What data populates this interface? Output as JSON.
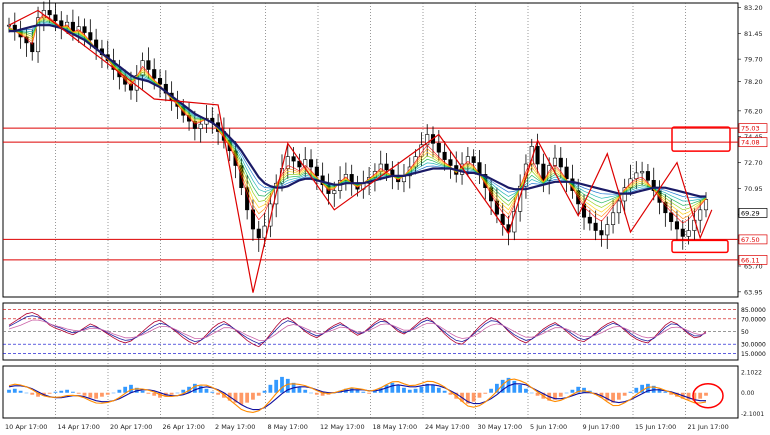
{
  "colors": {
    "background": "#ffffff",
    "grid": "#000000",
    "candle": "#000000",
    "ma": "#1a1a66",
    "zigzag": "#dd0000",
    "level_lines": "#dd0000",
    "highlight_box": "#ff0000",
    "rsi_fast": "#b00030",
    "rsi_slow": "#2020a0",
    "rsi_levels_upper": "#cc0000",
    "rsi_levels_lower": "#0000cc",
    "macd_signal": "#1010a0",
    "macd_line": "#ff8c00",
    "hist_pos": "#3399ff",
    "hist_neg": "#ff9966"
  },
  "chart_data": [
    {
      "type": "candlestick",
      "panel": "main",
      "price_axis_ticks": [
        "83.20",
        "81.45",
        "79.70",
        "78.20",
        "76.20",
        "74.45",
        "72.70",
        "70.95",
        "69.20",
        "67.45",
        "65.70",
        "63.95"
      ],
      "price_tags": [
        {
          "label": "75.03",
          "style": "red"
        },
        {
          "label": "74.08",
          "style": "red"
        },
        {
          "label": "69.29",
          "style": "current"
        },
        {
          "label": "67.50",
          "style": "red"
        },
        {
          "label": "66.11",
          "style": "red"
        }
      ],
      "horizontal_levels": [
        75.03,
        74.08,
        67.5,
        66.11
      ],
      "ylim": [
        63.6,
        83.5
      ],
      "close_series": [
        82.0,
        81.6,
        81.2,
        80.8,
        80.2,
        82.5,
        83.0,
        82.7,
        82.3,
        81.9,
        82.2,
        81.6,
        81.9,
        81.5,
        81.0,
        80.4,
        80.0,
        79.6,
        79.0,
        78.5,
        78.0,
        77.6,
        78.6,
        79.6,
        79.0,
        78.4,
        78.0,
        77.4,
        76.9,
        76.5,
        75.9,
        75.5,
        75.0,
        75.3,
        75.7,
        75.4,
        74.8,
        74.2,
        73.5,
        72.5,
        71.0,
        69.5,
        68.2,
        67.6,
        68.4,
        69.9,
        71.3,
        72.3,
        73.1,
        72.8,
        72.4,
        72.9,
        72.4,
        71.8,
        71.2,
        70.6,
        70.8,
        71.5,
        71.9,
        71.3,
        70.9,
        71.3,
        71.7,
        72.1,
        72.6,
        72.2,
        71.8,
        71.4,
        71.8,
        72.4,
        73.1,
        73.9,
        74.6,
        74.0,
        73.4,
        72.9,
        72.5,
        71.9,
        72.6,
        73.1,
        72.7,
        71.9,
        71.0,
        70.1,
        69.2,
        68.5,
        68.0,
        69.4,
        71.1,
        72.6,
        73.8,
        72.6,
        71.5,
        72.5,
        73.0,
        72.4,
        71.6,
        70.8,
        69.9,
        69.0,
        68.6,
        68.1,
        67.8,
        68.5,
        69.3,
        70.1,
        71.0,
        71.6,
        72.0,
        72.1,
        71.5,
        70.8,
        70.0,
        69.3,
        68.7,
        68.2,
        67.7,
        68.1,
        68.8,
        69.5,
        70.2
      ],
      "ma_series": [
        81.6,
        81.6,
        81.7,
        81.8,
        81.9,
        82.0,
        82.0,
        82.0,
        81.9,
        81.8,
        81.6,
        81.4,
        81.2,
        81.0,
        80.7,
        80.4,
        80.1,
        79.8,
        79.5,
        79.2,
        78.9,
        78.6,
        78.4,
        78.3,
        78.2,
        78.0,
        77.8,
        77.5,
        77.2,
        76.9,
        76.6,
        76.3,
        76.0,
        75.8,
        75.6,
        75.4,
        75.1,
        74.8,
        74.4,
        74.0,
        73.5,
        72.9,
        72.3,
        71.7,
        71.3,
        71.1,
        71.0,
        71.0,
        71.1,
        71.3,
        71.5,
        71.6,
        71.6,
        71.5,
        71.4,
        71.3,
        71.2,
        71.2,
        71.3,
        71.3,
        71.3,
        71.3,
        71.4,
        71.5,
        71.6,
        71.7,
        71.8,
        71.8,
        71.8,
        71.9,
        72.0,
        72.1,
        72.2,
        72.3,
        72.3,
        72.3,
        72.3,
        72.2,
        72.1,
        72.0,
        72.0,
        71.9,
        71.8,
        71.6,
        71.4,
        71.2,
        71.0,
        70.9,
        70.9,
        70.9,
        71.0,
        71.1,
        71.2,
        71.3,
        71.4,
        71.4,
        71.4,
        71.4,
        71.3,
        71.2,
        71.1,
        71.0,
        70.9,
        70.8,
        70.7,
        70.6,
        70.6,
        70.6,
        70.7,
        70.8,
        70.9,
        71.0,
        71.0,
        71.0,
        70.9,
        70.8,
        70.7,
        70.6,
        70.5,
        70.4,
        70.4
      ],
      "zigzag_series": [
        [
          0,
          82.0
        ],
        [
          5,
          83.0
        ],
        [
          25,
          77.0
        ],
        [
          36,
          76.6
        ],
        [
          42,
          63.9
        ],
        [
          48,
          74.0
        ],
        [
          56,
          69.5
        ],
        [
          74,
          74.6
        ],
        [
          86,
          67.9
        ],
        [
          91,
          74.2
        ],
        [
          98,
          69.1
        ],
        [
          103,
          73.3
        ],
        [
          107,
          68.0
        ],
        [
          115,
          72.7
        ],
        [
          119,
          67.6
        ],
        [
          121,
          69.5
        ]
      ]
    },
    {
      "type": "line",
      "panel": "rsi",
      "axis_ticks": [
        "85.0000",
        "70.0000",
        "50",
        "30.0000",
        "15.0000"
      ],
      "levels": [
        85,
        70,
        50,
        30,
        15
      ],
      "ylim": [
        5,
        95
      ],
      "series": [
        {
          "values": [
            60,
            66,
            72,
            78,
            80,
            76,
            68,
            60,
            55,
            52,
            48,
            45,
            50,
            56,
            62,
            58,
            52,
            46,
            40,
            35,
            32,
            35,
            42,
            50,
            58,
            65,
            68,
            62,
            55,
            48,
            40,
            34,
            30,
            36,
            45,
            55,
            62,
            66,
            60,
            52,
            44,
            36,
            30,
            26,
            34,
            46,
            58,
            68,
            72,
            66,
            58,
            50,
            44,
            40,
            46,
            54,
            60,
            64,
            58,
            50,
            44,
            48,
            56,
            64,
            70,
            66,
            58,
            50,
            46,
            52,
            60,
            68,
            72,
            66,
            56,
            46,
            38,
            32,
            30,
            38,
            48,
            58,
            66,
            72,
            68,
            60,
            50,
            42,
            36,
            32,
            38,
            46,
            54,
            60,
            64,
            58,
            50,
            42,
            36,
            34,
            40,
            48,
            56,
            62,
            66,
            60,
            52,
            44,
            38,
            34,
            32,
            40,
            50,
            60,
            66,
            62,
            54,
            46,
            40,
            42,
            50
          ]
        },
        {
          "values": [
            58,
            63,
            68,
            73,
            75,
            73,
            68,
            62,
            58,
            55,
            51,
            48,
            50,
            54,
            58,
            57,
            53,
            48,
            43,
            39,
            36,
            37,
            41,
            47,
            53,
            59,
            63,
            61,
            56,
            50,
            44,
            38,
            34,
            36,
            42,
            50,
            57,
            62,
            59,
            53,
            46,
            40,
            35,
            31,
            34,
            43,
            53,
            62,
            67,
            64,
            58,
            52,
            47,
            43,
            46,
            52,
            57,
            61,
            58,
            52,
            47,
            48,
            54,
            61,
            66,
            65,
            59,
            53,
            48,
            51,
            57,
            64,
            68,
            65,
            57,
            49,
            42,
            36,
            34,
            38,
            46,
            54,
            62,
            67,
            66,
            60,
            52,
            45,
            40,
            36,
            38,
            44,
            51,
            57,
            61,
            58,
            52,
            46,
            40,
            37,
            40,
            46,
            53,
            59,
            63,
            60,
            54,
            47,
            41,
            37,
            35,
            39,
            47,
            56,
            62,
            61,
            55,
            48,
            43,
            43,
            48
          ]
        },
        {
          "values": [
            54,
            57,
            60,
            64,
            68,
            68,
            66,
            62,
            59,
            57,
            54,
            52,
            51,
            52,
            55,
            55,
            53,
            50,
            46,
            43,
            40,
            40,
            42,
            45,
            49,
            54,
            58,
            58,
            56,
            52,
            47,
            43,
            39,
            39,
            41,
            46,
            51,
            56,
            56,
            53,
            49,
            44,
            40,
            36,
            36,
            40,
            46,
            53,
            59,
            61,
            59,
            55,
            51,
            47,
            47,
            50,
            53,
            57,
            56,
            53,
            49,
            49,
            52,
            56,
            61,
            62,
            60,
            56,
            52,
            52,
            54,
            59,
            63,
            63,
            59,
            53,
            47,
            42,
            39,
            40,
            43,
            48,
            55,
            60,
            62,
            60,
            55,
            50,
            45,
            41,
            41,
            43,
            47,
            52,
            56,
            56,
            54,
            50,
            45,
            42,
            42,
            44,
            48,
            53,
            57,
            58,
            55,
            51,
            46,
            42,
            40,
            41,
            45,
            51,
            56,
            57,
            55,
            51,
            47,
            45,
            47
          ]
        }
      ]
    },
    {
      "type": "bar+line",
      "panel": "macd",
      "axis_ticks": [
        "2.1022",
        "0.00",
        "-2.1001"
      ],
      "ylim": [
        -2.55,
        2.7
      ],
      "histogram": [
        0.3,
        0.4,
        0.2,
        0.0,
        -0.2,
        -0.4,
        -0.3,
        -0.1,
        0.1,
        0.2,
        0.3,
        0.1,
        -0.1,
        -0.3,
        -0.5,
        -0.6,
        -0.4,
        -0.2,
        0.0,
        0.3,
        0.6,
        0.8,
        0.5,
        0.2,
        -0.1,
        -0.3,
        -0.5,
        -0.4,
        -0.2,
        0.0,
        0.3,
        0.6,
        0.9,
        0.7,
        0.4,
        0.1,
        -0.2,
        -0.5,
        -0.8,
        -1.0,
        -1.2,
        -1.0,
        -0.7,
        -0.3,
        0.2,
        0.8,
        1.3,
        1.6,
        1.4,
        1.0,
        0.6,
        0.3,
        0.0,
        -0.2,
        -0.3,
        -0.2,
        0.0,
        0.2,
        0.4,
        0.5,
        0.3,
        0.1,
        -0.1,
        0.2,
        0.5,
        0.8,
        1.0,
        0.8,
        0.5,
        0.3,
        0.4,
        0.6,
        0.9,
        0.8,
        0.5,
        0.2,
        -0.2,
        -0.6,
        -0.9,
        -1.1,
        -0.9,
        -0.5,
        -0.1,
        0.4,
        0.9,
        1.3,
        1.5,
        1.2,
        0.8,
        0.4,
        0.0,
        -0.3,
        -0.6,
        -0.8,
        -0.7,
        -0.4,
        0.0,
        0.3,
        0.6,
        0.5,
        0.2,
        -0.2,
        -0.5,
        -0.8,
        -1.0,
        -0.7,
        -0.3,
        0.1,
        0.5,
        0.8,
        0.9,
        0.7,
        0.4,
        0.1,
        -0.2,
        -0.4,
        -0.6,
        -0.7,
        -0.8,
        -0.6,
        -0.3
      ],
      "signal": [
        0.6,
        0.7,
        0.7,
        0.6,
        0.4,
        0.1,
        -0.2,
        -0.4,
        -0.5,
        -0.5,
        -0.4,
        -0.3,
        -0.3,
        -0.4,
        -0.6,
        -0.8,
        -0.9,
        -0.9,
        -0.8,
        -0.6,
        -0.3,
        0.0,
        0.2,
        0.3,
        0.3,
        0.2,
        0.0,
        -0.2,
        -0.3,
        -0.3,
        -0.2,
        0.0,
        0.3,
        0.5,
        0.6,
        0.5,
        0.3,
        0.0,
        -0.4,
        -0.8,
        -1.2,
        -1.5,
        -1.7,
        -1.7,
        -1.5,
        -1.1,
        -0.6,
        -0.1,
        0.3,
        0.5,
        0.6,
        0.6,
        0.5,
        0.3,
        0.1,
        0.0,
        0.0,
        0.1,
        0.2,
        0.3,
        0.3,
        0.3,
        0.2,
        0.2,
        0.3,
        0.5,
        0.7,
        0.8,
        0.7,
        0.6,
        0.6,
        0.7,
        0.8,
        0.8,
        0.7,
        0.5,
        0.2,
        -0.1,
        -0.5,
        -0.9,
        -1.1,
        -1.1,
        -0.9,
        -0.6,
        -0.2,
        0.3,
        0.7,
        0.9,
        0.9,
        0.8,
        0.5,
        0.2,
        -0.1,
        -0.4,
        -0.6,
        -0.6,
        -0.5,
        -0.3,
        -0.1,
        0.0,
        0.0,
        -0.1,
        -0.3,
        -0.6,
        -0.9,
        -1.0,
        -0.9,
        -0.7,
        -0.4,
        -0.1,
        0.2,
        0.3,
        0.3,
        0.2,
        0.1,
        -0.1,
        -0.3,
        -0.5,
        -0.7,
        -0.8,
        -0.8
      ]
    }
  ],
  "time_axis": {
    "labels": [
      "10 Apr 17:00",
      "14 Apr 17:00",
      "20 Apr 17:00",
      "26 Apr 17:00",
      "2 May 17:00",
      "8 May 17:00",
      "12 May 17:00",
      "18 May 17:00",
      "24 May 17:00",
      "30 May 17:00",
      "5 Jun 17:00",
      "9 Jun 17:00",
      "15 Jun 17:00",
      "21 Jun 17:00"
    ]
  }
}
